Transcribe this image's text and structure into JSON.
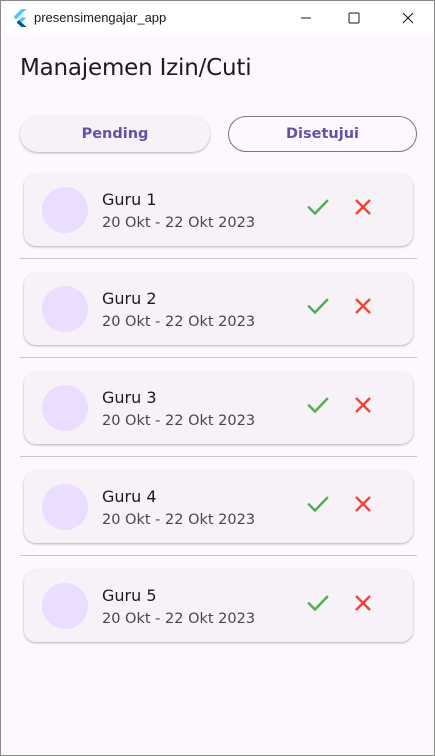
{
  "window": {
    "title": "presensimengajar_app",
    "icons": {
      "app": "flutter-logo-icon",
      "minimize": "minimize-icon",
      "maximize": "maximize-icon",
      "close": "close-icon"
    }
  },
  "page": {
    "title": "Manajemen Izin/Cuti"
  },
  "tabs": [
    {
      "label": "Pending",
      "selected": false
    },
    {
      "label": "Disetujui",
      "selected": true
    }
  ],
  "requests": [
    {
      "name": "Guru 1",
      "dates": "20 Okt - 22 Okt 2023"
    },
    {
      "name": "Guru 2",
      "dates": "20 Okt - 22 Okt 2023"
    },
    {
      "name": "Guru 3",
      "dates": "20 Okt - 22 Okt 2023"
    },
    {
      "name": "Guru 4",
      "dates": "20 Okt - 22 Okt 2023"
    },
    {
      "name": "Guru 5",
      "dates": "20 Okt - 22 Okt 2023"
    }
  ],
  "actions": {
    "approve_icon": "check-icon",
    "reject_icon": "x-icon"
  },
  "colors": {
    "primary": "#6750a4",
    "approve": "#4caf50",
    "reject": "#f44336",
    "avatar": "#eaddff",
    "background": "#fdf7ff"
  }
}
